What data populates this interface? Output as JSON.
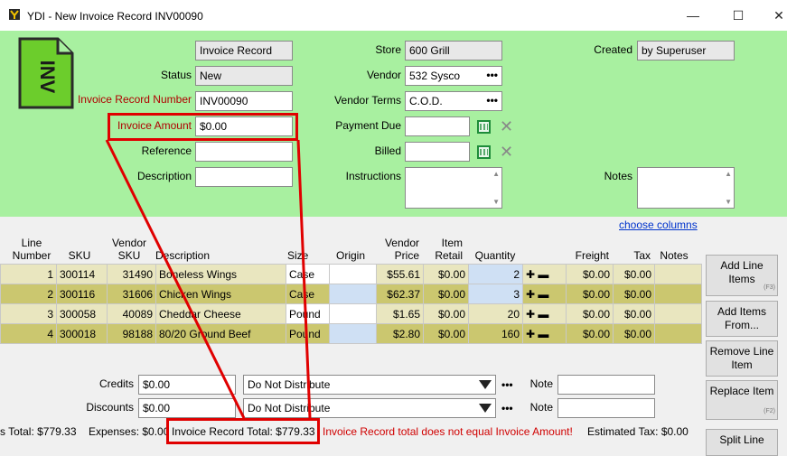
{
  "window": {
    "title": "YDI - New Invoice Record INV00090",
    "minimize": "—",
    "maximize": "☐",
    "close": "✕"
  },
  "form": {
    "record_type": "Invoice Record",
    "status_label": "Status",
    "status_value": "New",
    "number_label": "Invoice Record Number",
    "number_value": "INV00090",
    "amount_label": "Invoice Amount",
    "amount_value": "$0.00",
    "reference_label": "Reference",
    "reference_value": "",
    "description_label": "Description",
    "description_value": "",
    "store_label": "Store",
    "store_value": "600 Grill",
    "vendor_label": "Vendor",
    "vendor_value": "532 Sysco",
    "vendor_terms_label": "Vendor Terms",
    "vendor_terms_value": "C.O.D.",
    "payment_due_label": "Payment Due",
    "payment_due_value": "",
    "billed_label": "Billed",
    "billed_value": "",
    "instructions_label": "Instructions",
    "instructions_value": "",
    "created_label": "Created",
    "created_value": "by Superuser",
    "notes_label": "Notes",
    "notes_value": "",
    "dots": "•••",
    "icon_text": "INV"
  },
  "grid": {
    "choose_columns": "choose columns",
    "headers": {
      "line_number": [
        "Line",
        "Number"
      ],
      "sku": "SKU",
      "vendor_sku": [
        "Vendor",
        "SKU"
      ],
      "description": "Description",
      "size": "Size",
      "origin": "Origin",
      "vendor_price": [
        "Vendor",
        "Price"
      ],
      "item_retail": [
        "Item",
        "Retail"
      ],
      "quantity": "Quantity",
      "freight": "Freight",
      "tax": "Tax",
      "notes": "Notes"
    },
    "rows": [
      {
        "line": "1",
        "sku": "300114",
        "vendor_sku": "31490",
        "description": "Boneless Wings",
        "size": "Case",
        "origin": "",
        "vendor_price": "$55.61",
        "item_retail": "$0.00",
        "quantity": "2",
        "freight": "$0.00",
        "tax": "$0.00",
        "notes": ""
      },
      {
        "line": "2",
        "sku": "300116",
        "vendor_sku": "31606",
        "description": "Chicken Wings",
        "size": "Case",
        "origin": "",
        "vendor_price": "$62.37",
        "item_retail": "$0.00",
        "quantity": "3",
        "freight": "$0.00",
        "tax": "$0.00",
        "notes": ""
      },
      {
        "line": "3",
        "sku": "300058",
        "vendor_sku": "40089",
        "description": "Cheddar Cheese",
        "size": "Pound",
        "origin": "",
        "vendor_price": "$1.65",
        "item_retail": "$0.00",
        "quantity": "20",
        "freight": "$0.00",
        "tax": "$0.00",
        "notes": ""
      },
      {
        "line": "4",
        "sku": "300018",
        "vendor_sku": "98188",
        "description": "80/20 Ground Beef",
        "size": "Pound",
        "origin": "",
        "vendor_price": "$2.80",
        "item_retail": "$0.00",
        "quantity": "160",
        "freight": "$0.00",
        "tax": "$0.00",
        "notes": ""
      }
    ],
    "plus": "✚",
    "minus": "▬"
  },
  "side_buttons": {
    "add_line_items": "Add Line Items",
    "add_line_items_key": "(F3)",
    "add_items_from": "Add Items From...",
    "remove_line_item": "Remove Line Item",
    "replace_item": "Replace Item",
    "replace_item_key": "(F2)",
    "split_line": "Split Line"
  },
  "footer": {
    "credits_label": "Credits",
    "credits_value": "$0.00",
    "discounts_label": "Discounts",
    "discounts_value": "$0.00",
    "credits_distribute": "Do Not Distribute",
    "discounts_distribute": "Do Not Distribute",
    "note_label": "Note",
    "items_total": "s Total: $779.33",
    "expenses": "Expenses: $0.00",
    "invoice_total": "Invoice Record Total: $779.33",
    "warning": "Invoice Record total does not equal Invoice Amount!",
    "estimated_tax": "Estimated Tax: $0.00"
  },
  "colors": {
    "form_bg": "#a8f0a0",
    "annotation": "#e00000",
    "warning": "#d00000",
    "link": "#0033cc"
  }
}
